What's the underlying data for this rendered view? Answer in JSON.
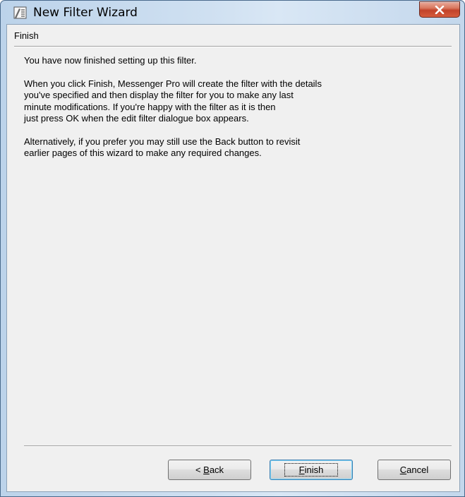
{
  "window": {
    "title": "New Filter Wizard",
    "icon": "wizard-app-icon",
    "close_icon": "close-x-icon"
  },
  "page": {
    "header": "Finish",
    "paragraphs": [
      "You have now finished setting up this filter.",
      "When you click Finish, Messenger Pro will create the filter with the details\nyou've specified and then display the filter for you to make any last\nminute modifications.  If you're happy with the filter as it is then\njust press OK when the edit filter dialogue box appears.",
      "Alternatively, if you prefer you may still use the Back button to revisit\nearlier pages of this wizard to make any required changes."
    ]
  },
  "buttons": {
    "back": {
      "prefix": "< ",
      "mnemonic": "B",
      "rest": "ack"
    },
    "finish": {
      "prefix": "",
      "mnemonic": "F",
      "rest": "inish"
    },
    "cancel": {
      "prefix": "",
      "mnemonic": "C",
      "rest": "ancel"
    }
  },
  "colors": {
    "client_bg": "#f0f0f0",
    "close_button": "#c2432a",
    "default_button_border": "#3c7fb1"
  }
}
